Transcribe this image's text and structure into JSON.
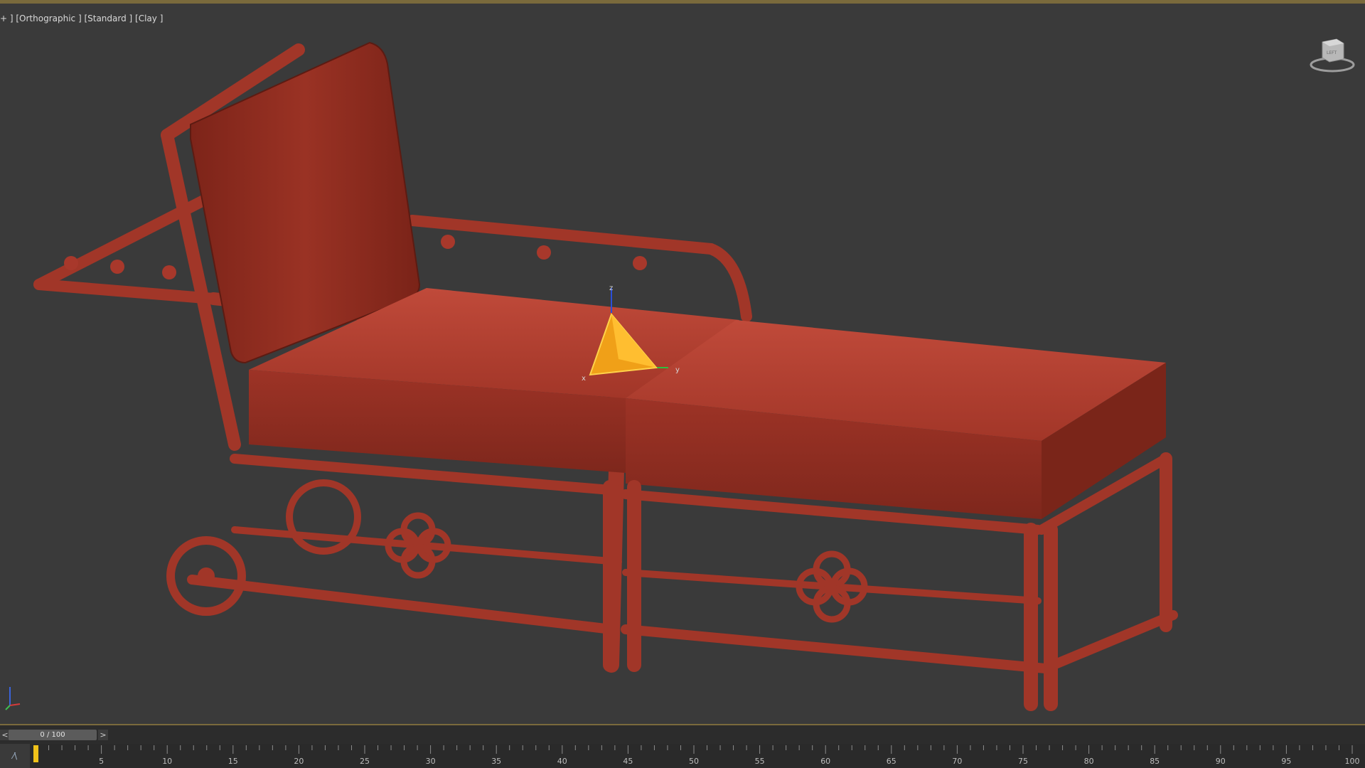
{
  "viewport": {
    "label": "+ ] [Orthographic ] [Standard ] [Clay ]"
  },
  "gizmo": {
    "x_label": "x",
    "y_label": "y",
    "z_label": "z"
  },
  "viewcube": {
    "face_label": "LEFT"
  },
  "time_slider": {
    "value": "0 / 100",
    "prev": "<",
    "next": ">",
    "current_frame": 0,
    "max_frame": 100
  },
  "trackbar": {
    "curve_toggle": "⁄\\",
    "ticks": [
      "5",
      "10",
      "15",
      "20",
      "25",
      "30",
      "35",
      "40",
      "45",
      "50",
      "55",
      "60",
      "65",
      "70",
      "75",
      "80",
      "85",
      "90",
      "95",
      "100"
    ]
  },
  "colors": {
    "viewport_bg": "#3a3a3a",
    "clay": "#a8382b",
    "clay_dark": "#6e2219",
    "gizmo": "#f0b020"
  }
}
